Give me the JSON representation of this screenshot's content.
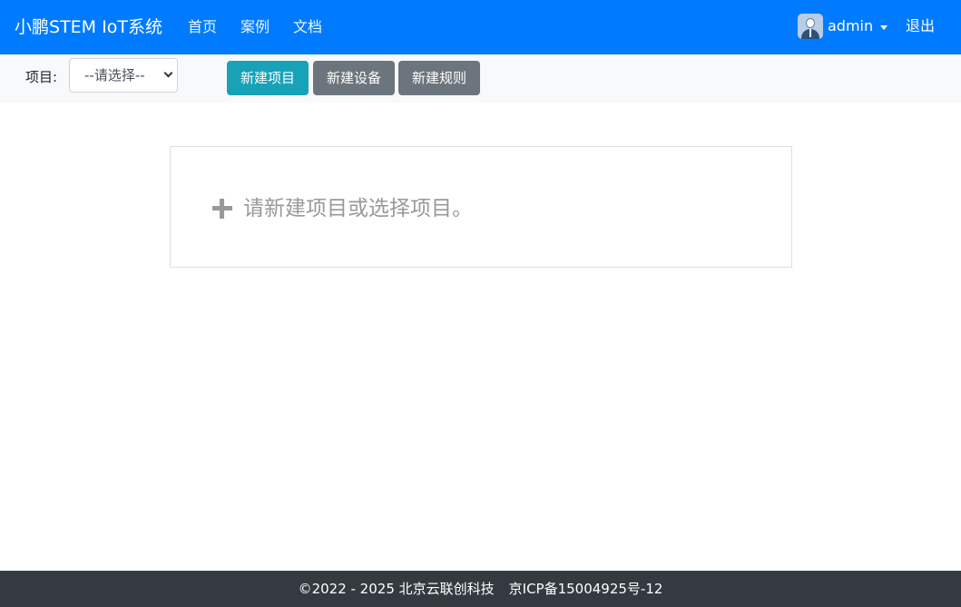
{
  "navbar": {
    "brand": "小鹏STEM IoT系统",
    "links": [
      "首页",
      "案例",
      "文档"
    ],
    "user": "admin",
    "logout": "退出",
    "color": "#007bff"
  },
  "toolbar": {
    "project_label": "项目:",
    "project_select_value": "--请选择--",
    "buttons": [
      "新建项目",
      "新建设备",
      "新建规则"
    ]
  },
  "main": {
    "message": "请新建项目或选择项目。",
    "icon": "plus-icon"
  },
  "footer": {
    "copyright": "©2022 - 2025 北京云联创科技",
    "icp": "京ICP备15004925号-12"
  }
}
